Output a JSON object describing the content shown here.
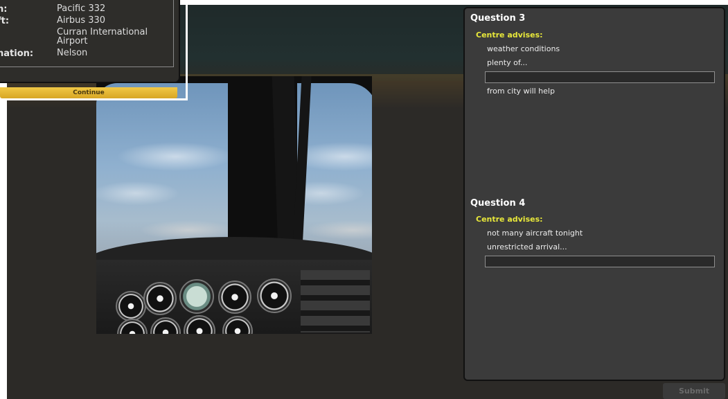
{
  "flight_info": {
    "rows": [
      {
        "key": "n:",
        "value": "Pacific 332"
      },
      {
        "key": "ft:",
        "value": "Airbus 330"
      },
      {
        "key": ":",
        "value": "Curran International Airport"
      },
      {
        "key": "nation:",
        "value": "Nelson"
      }
    ],
    "continue_label": "Continue"
  },
  "questions": [
    {
      "title": "Question 3",
      "advises": "Centre advises:",
      "line1": "weather conditions",
      "line2": "plenty of...",
      "input_value": "",
      "line3": "from city will help"
    },
    {
      "title": "Question 4",
      "advises": "Centre advises:",
      "line1": "not many aircraft tonight",
      "line2": "unrestricted arrival...",
      "input_value": ""
    }
  ],
  "submit_label": "Submit",
  "colors": {
    "accent_yellow": "#e8e83a",
    "continue_gold": "#e2b437",
    "panel_bg": "#3b3b3b"
  }
}
